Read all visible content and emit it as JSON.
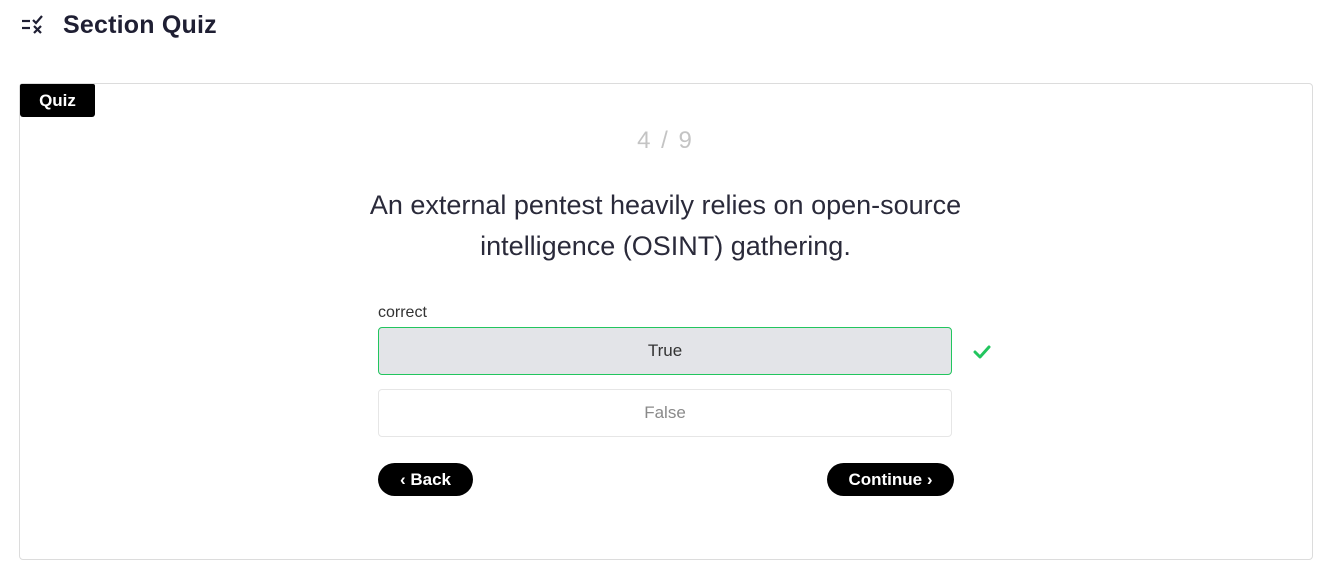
{
  "header": {
    "title": "Section Quiz",
    "icon": "checklist-icon"
  },
  "quiz": {
    "tag": "Quiz",
    "progress": "4 / 9",
    "question": "An external pentest heavily relies on open-source intelligence (OSINT) gathering.",
    "status_label": "correct",
    "options": [
      {
        "label": "True",
        "selected": true,
        "correct": true
      },
      {
        "label": "False",
        "selected": false
      }
    ],
    "back_label": "‹ Back",
    "continue_label": "Continue ›"
  },
  "colors": {
    "accent": "#000000",
    "correct": "#22c55e",
    "selected_bg": "#e3e4e8",
    "progress_text": "#c4c4c4"
  }
}
